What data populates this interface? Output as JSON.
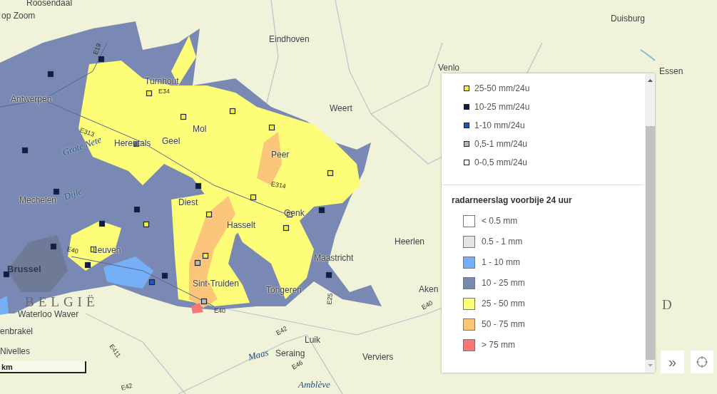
{
  "map": {
    "labels": [
      {
        "kind": "city",
        "text": "Roosendaal"
      },
      {
        "kind": "city",
        "text": "op Zoom"
      },
      {
        "kind": "city",
        "text": "Eindhoven"
      },
      {
        "kind": "city",
        "text": "Duisburg"
      },
      {
        "kind": "city",
        "text": "Venlo"
      },
      {
        "kind": "city",
        "text": "Essen"
      },
      {
        "kind": "city",
        "text": "Antwerpen"
      },
      {
        "kind": "city",
        "text": "Turnhout"
      },
      {
        "kind": "city",
        "text": "Weert"
      },
      {
        "kind": "city",
        "text": "Mol"
      },
      {
        "kind": "city",
        "text": "Herentals"
      },
      {
        "kind": "city",
        "text": "Geel"
      },
      {
        "kind": "city",
        "text": "Peer"
      },
      {
        "kind": "city",
        "text": "Mechelen"
      },
      {
        "kind": "city",
        "text": "Diest"
      },
      {
        "kind": "city",
        "text": "Hasselt"
      },
      {
        "kind": "city",
        "text": "Genk"
      },
      {
        "kind": "city",
        "text": "Leuven"
      },
      {
        "kind": "capital",
        "text": "Brussel"
      },
      {
        "kind": "city",
        "text": "Maastricht"
      },
      {
        "kind": "city",
        "text": "Heerlen"
      },
      {
        "kind": "city",
        "text": "Aken"
      },
      {
        "kind": "city",
        "text": "Sint-Truiden"
      },
      {
        "kind": "city",
        "text": "Tongeren"
      },
      {
        "kind": "country",
        "text": "BELGIË"
      },
      {
        "kind": "city",
        "text": "Waterloo Waver"
      },
      {
        "kind": "city",
        "text": "enbrakel"
      },
      {
        "kind": "city",
        "text": "Nivelles"
      },
      {
        "kind": "city",
        "text": "Luik"
      },
      {
        "kind": "city",
        "text": "Seraing"
      },
      {
        "kind": "city",
        "text": "Verviers"
      },
      {
        "kind": "country",
        "text": "D"
      },
      {
        "kind": "river",
        "text": "Grote Nete"
      },
      {
        "kind": "river",
        "text": "Dijle"
      },
      {
        "kind": "river",
        "text": "Maas"
      },
      {
        "kind": "river",
        "text": "Amblève"
      },
      {
        "kind": "road",
        "text": "E19"
      },
      {
        "kind": "road",
        "text": "E34"
      },
      {
        "kind": "road",
        "text": "E313"
      },
      {
        "kind": "road",
        "text": "E314"
      },
      {
        "kind": "road",
        "text": "E40"
      },
      {
        "kind": "road",
        "text": "E40"
      },
      {
        "kind": "road",
        "text": "E40"
      },
      {
        "kind": "road",
        "text": "E42"
      },
      {
        "kind": "road",
        "text": "E42"
      },
      {
        "kind": "road",
        "text": "E411"
      },
      {
        "kind": "road",
        "text": "E25"
      },
      {
        "kind": "road",
        "text": "E46"
      }
    ],
    "scale": "km"
  },
  "legend": {
    "stations": [
      {
        "label": "25-50 mm/24u",
        "color": "#f5ef3a"
      },
      {
        "label": "10-25 mm/24u",
        "color": "#0d1e4a"
      },
      {
        "label": "1-10 mm/24u",
        "color": "#1e56c8"
      },
      {
        "label": "0,5-1 mm/24u",
        "color": "#b8b8b8"
      },
      {
        "label": "0-0,5 mm/24u",
        "color": "#ffffff"
      }
    ],
    "radar": {
      "title": "radarneerslag voorbije 24 uur",
      "items": [
        {
          "label": "< 0.5 mm",
          "color": "#ffffff"
        },
        {
          "label": "0.5 - 1 mm",
          "color": "#e4e4e4"
        },
        {
          "label": "1 - 10 mm",
          "color": "#75aff5"
        },
        {
          "label": "10 - 25 mm",
          "color": "#7a89b3"
        },
        {
          "label": "25 - 50 mm",
          "color": "#fdfd78"
        },
        {
          "label": "50 - 75 mm",
          "color": "#fbc57a"
        },
        {
          "label": "> 75 mm",
          "color": "#f77777"
        }
      ]
    }
  },
  "controls": {
    "collapse": "»"
  }
}
